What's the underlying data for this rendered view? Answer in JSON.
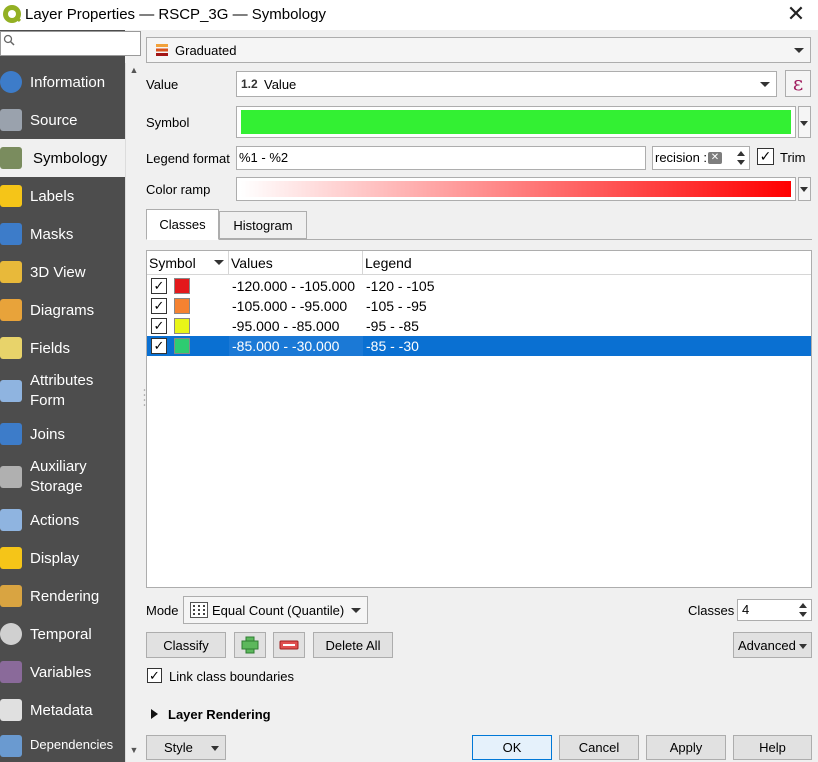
{
  "window": {
    "title": "Layer Properties — RSCP_3G — Symbology",
    "close_glyph": "✕"
  },
  "sidebar": {
    "search_placeholder": "",
    "items": [
      {
        "label": "Information",
        "icon": "info-icon"
      },
      {
        "label": "Source",
        "icon": "source-wrench-icon"
      },
      {
        "label": "Symbology",
        "icon": "paintbrush-icon",
        "selected": true
      },
      {
        "label": "Labels",
        "icon": "abc-labels-icon"
      },
      {
        "label": "Masks",
        "icon": "abc-masks-icon"
      },
      {
        "label": "3D View",
        "icon": "cube-icon"
      },
      {
        "label": "Diagrams",
        "icon": "diagram-icon"
      },
      {
        "label": "Fields",
        "icon": "fields-icon"
      },
      {
        "label": "Attributes Form",
        "line1": "Attributes",
        "line2": "Form",
        "icon": "form-icon"
      },
      {
        "label": "Joins",
        "icon": "joins-icon"
      },
      {
        "label": "Auxiliary Storage",
        "line1": "Auxiliary",
        "line2": "Storage",
        "icon": "database-icon"
      },
      {
        "label": "Actions",
        "icon": "actions-gear-icon"
      },
      {
        "label": "Display",
        "icon": "display-bubble-icon"
      },
      {
        "label": "Rendering",
        "icon": "rendering-brush-icon"
      },
      {
        "label": "Temporal",
        "icon": "clock-icon"
      },
      {
        "label": "Variables",
        "icon": "variables-icon"
      },
      {
        "label": "Metadata",
        "icon": "metadata-icon"
      },
      {
        "label": "Dependencies",
        "icon": "dependencies-icon"
      }
    ]
  },
  "renderer": {
    "selected": "Graduated"
  },
  "form": {
    "value_label": "Value",
    "value_type": "1.2",
    "value_field": "Value",
    "expression_glyph": "ε",
    "symbol_label": "Symbol",
    "symbol_color": "#33f033",
    "legend_format_label": "Legend format",
    "legend_format_value": "%1 - %2",
    "precision_text": "recision :",
    "trim_label": "Trim",
    "trim_checked": true,
    "color_ramp_label": "Color ramp",
    "color_ramp": {
      "start": "#ffffff",
      "end": "#ff0000"
    }
  },
  "tabs": [
    {
      "label": "Classes",
      "active": true
    },
    {
      "label": "Histogram",
      "active": false
    }
  ],
  "table": {
    "headers": {
      "symbol": "Symbol",
      "values": "Values",
      "legend": "Legend"
    },
    "rows": [
      {
        "checked": true,
        "color": "#e3191c",
        "values": "-120.000 - -105.000",
        "legend": "-120 - -105",
        "selected": false
      },
      {
        "checked": true,
        "color": "#f58231",
        "values": "-105.000 - -95.000",
        "legend": "-105 - -95",
        "selected": false
      },
      {
        "checked": true,
        "color": "#e8f518",
        "values": "-95.000 - -85.000",
        "legend": "-95 - -85",
        "selected": false
      },
      {
        "checked": true,
        "color": "#2ecc71",
        "values": "-85.000 - -30.000",
        "legend": "-85 - -30",
        "selected": true
      }
    ]
  },
  "bottom": {
    "mode_label": "Mode",
    "mode_value": "Equal Count (Quantile)",
    "classes_label": "Classes",
    "classes_value": "4",
    "classify_label": "Classify",
    "delete_all_label": "Delete All",
    "advanced_label": "Advanced",
    "link_label": "Link class boundaries",
    "link_checked": true,
    "layer_rendering_label": "Layer Rendering"
  },
  "dialog_buttons": {
    "style": "Style",
    "ok": "OK",
    "cancel": "Cancel",
    "apply": "Apply",
    "help": "Help"
  },
  "check_glyph": "✓"
}
